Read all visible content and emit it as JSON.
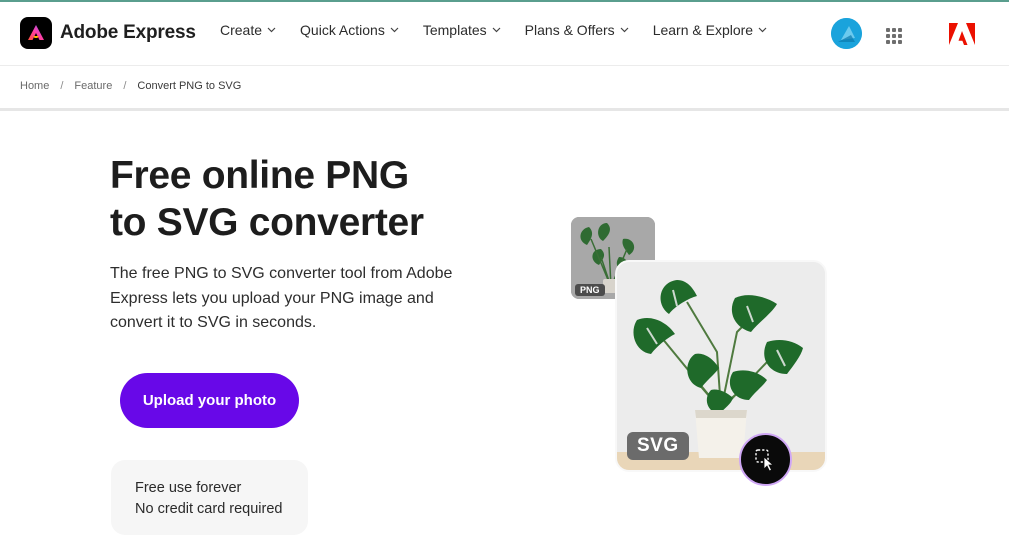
{
  "brand": {
    "name": "Adobe Express"
  },
  "nav": {
    "items": [
      {
        "label": "Create"
      },
      {
        "label": "Quick Actions"
      },
      {
        "label": "Templates"
      },
      {
        "label": "Plans & Offers"
      },
      {
        "label": "Learn & Explore"
      }
    ]
  },
  "breadcrumb": {
    "home": "Home",
    "feature": "Feature",
    "current": "Convert PNG to SVG",
    "separator": "/"
  },
  "hero": {
    "title_line1": "Free online PNG",
    "title_line2": "to SVG converter",
    "description": "The free PNG to SVG converter tool from Adobe Express lets you upload your PNG image and convert it to SVG in seconds.",
    "cta_label": "Upload your photo",
    "note_line1": "Free use forever",
    "note_line2": "No credit card required"
  },
  "illustration": {
    "png_label": "PNG",
    "svg_label": "SVG"
  },
  "colors": {
    "cta": "#6808e8",
    "avatar": "#1aa3dc",
    "adobe_red": "#eb1000",
    "topline": "#5a9e8e"
  },
  "icons": {
    "logo": "adobe-express-logo-icon",
    "avatar": "user-avatar-icon",
    "apps": "app-grid-icon",
    "adobe": "adobe-logo-icon",
    "action": "pointer-click-icon",
    "chevron": "chevron-down-icon"
  }
}
